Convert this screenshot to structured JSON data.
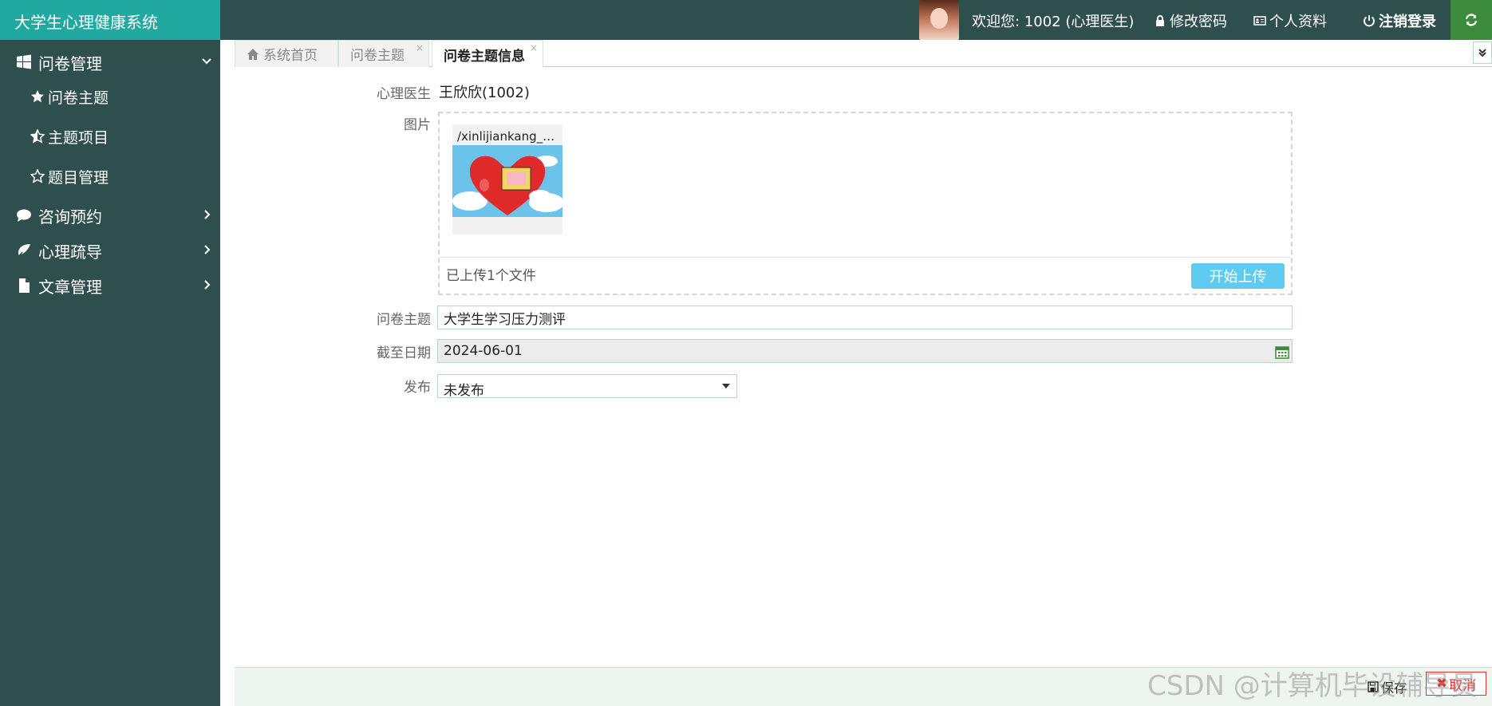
{
  "app": {
    "title": "大学生心理健康系统"
  },
  "header": {
    "welcome": "欢迎您: 1002 (心理医生)",
    "change_password": "修改密码",
    "profile": "个人资料",
    "logout": "注销登录"
  },
  "sidebar": {
    "groups": [
      {
        "label": "问卷管理",
        "items": [
          "问卷主题",
          "主题项目",
          "题目管理"
        ]
      },
      {
        "label": "咨询预约"
      },
      {
        "label": "心理疏导"
      },
      {
        "label": "文章管理"
      }
    ]
  },
  "tabs": [
    {
      "label": "系统首页"
    },
    {
      "label": "问卷主题",
      "close": "×"
    },
    {
      "label": "问卷主题信息",
      "close": "×"
    }
  ],
  "form": {
    "doctor_label": "心理医生",
    "doctor_value": "王欣欣(1002)",
    "image_label": "图片",
    "file_name": "/xinlijiankang_w...",
    "upload_status": "已上传1个文件",
    "upload_button": "开始上传",
    "topic_label": "问卷主题",
    "topic_value": "大学生学习压力测评",
    "deadline_label": "截至日期",
    "deadline_value": "2024-06-01",
    "publish_label": "发布",
    "publish_value": "未发布"
  },
  "footer": {
    "save": "保存",
    "cancel": "取消"
  },
  "watermark": "CSDN @计算机毕设辅导员",
  "colors": {
    "header_bg": "#2f4f4f",
    "brand_bg": "#1fa9a1",
    "upload_button": "#5fcbf0",
    "cancel": "#dd3333"
  }
}
